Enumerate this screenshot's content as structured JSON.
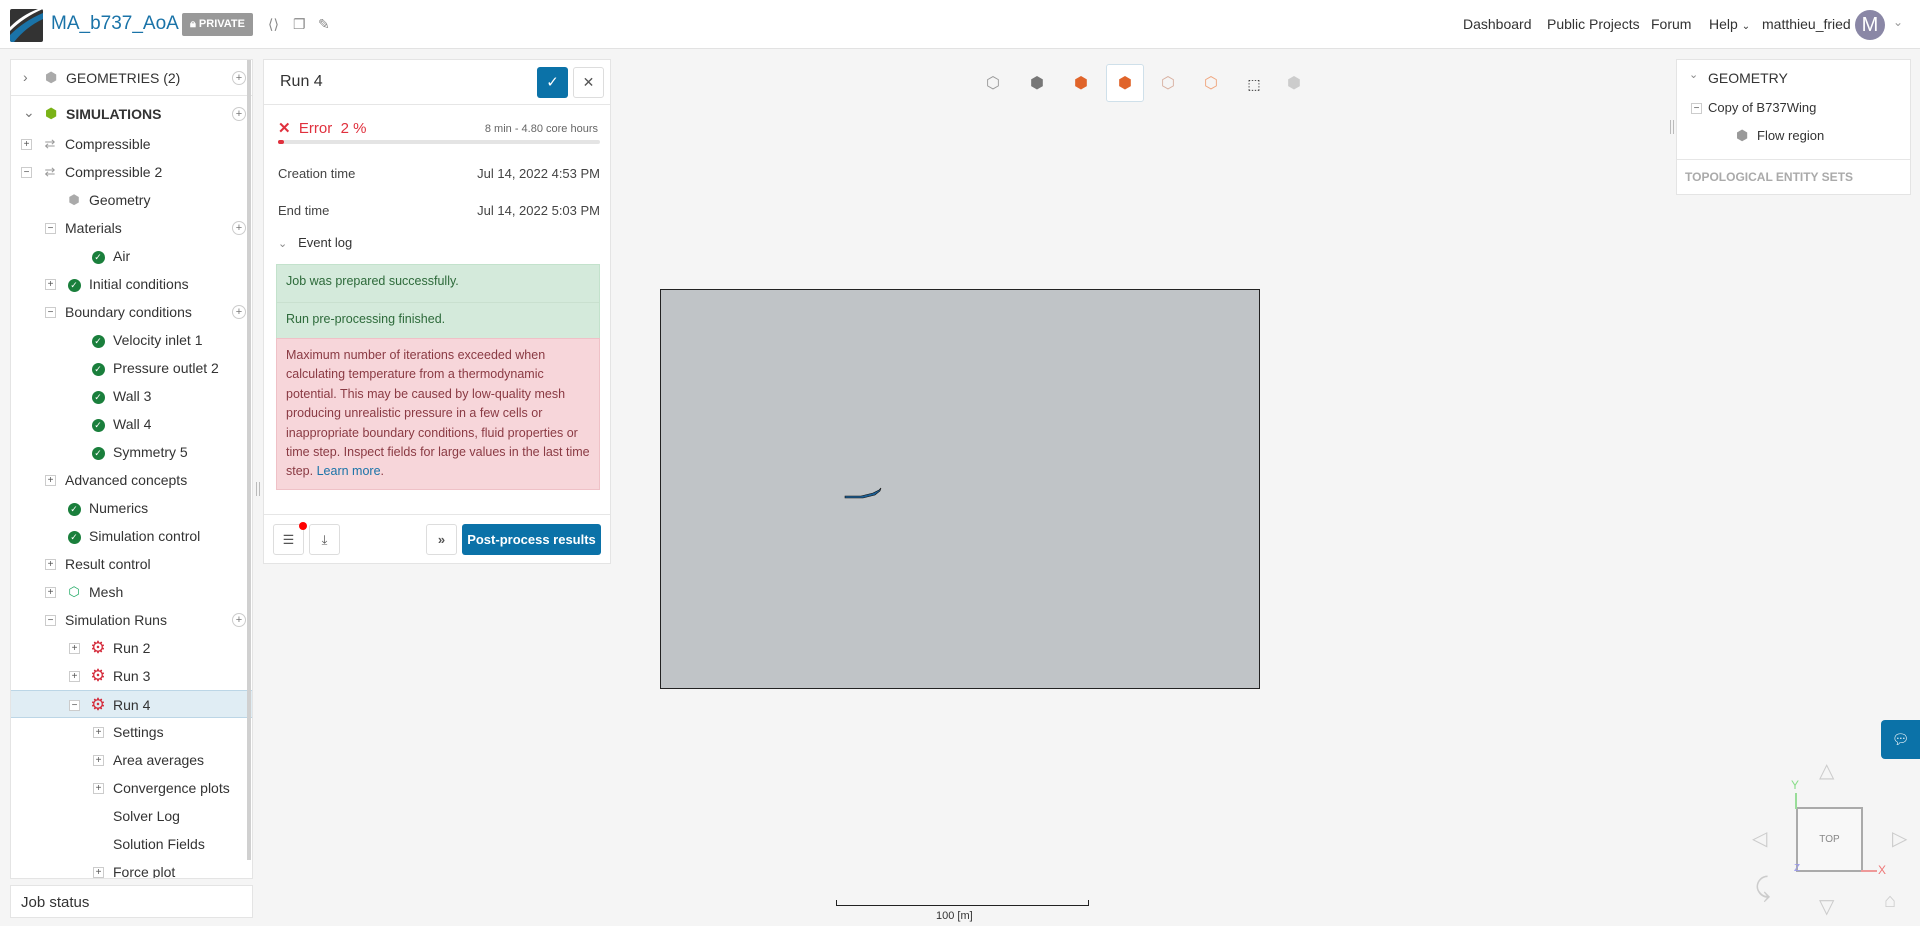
{
  "header": {
    "title": "MA_b737_AoA",
    "privacy": "PRIVATE",
    "nav": [
      "Dashboard",
      "Public Projects",
      "Forum",
      "Help"
    ],
    "user": "matthieu_fried",
    "avatar_letter": "M"
  },
  "tree": {
    "geometries": "GEOMETRIES (2)",
    "simulations": "SIMULATIONS",
    "items": [
      {
        "label": "Compressible",
        "depth": 0,
        "toggle": "+",
        "icon": "sim"
      },
      {
        "label": "Compressible 2",
        "depth": 0,
        "toggle": "−",
        "icon": "sim"
      },
      {
        "label": "Geometry",
        "depth": 1,
        "icon": "geom"
      },
      {
        "label": "Materials",
        "depth": 1,
        "toggle": "−",
        "add": true
      },
      {
        "label": "Air",
        "depth": 2,
        "icon": "check"
      },
      {
        "label": "Initial conditions",
        "depth": 1,
        "toggle": "+",
        "icon": "check"
      },
      {
        "label": "Boundary conditions",
        "depth": 1,
        "toggle": "−",
        "add": true
      },
      {
        "label": "Velocity inlet 1",
        "depth": 2,
        "icon": "check"
      },
      {
        "label": "Pressure outlet 2",
        "depth": 2,
        "icon": "check"
      },
      {
        "label": "Wall 3",
        "depth": 2,
        "icon": "check"
      },
      {
        "label": "Wall 4",
        "depth": 2,
        "icon": "check"
      },
      {
        "label": "Symmetry 5",
        "depth": 2,
        "icon": "check"
      },
      {
        "label": "Advanced concepts",
        "depth": 1,
        "toggle": "+"
      },
      {
        "label": "Numerics",
        "depth": 1,
        "icon": "check"
      },
      {
        "label": "Simulation control",
        "depth": 1,
        "icon": "check"
      },
      {
        "label": "Result control",
        "depth": 1,
        "toggle": "+"
      },
      {
        "label": "Mesh",
        "depth": 1,
        "toggle": "+",
        "icon": "mesh"
      },
      {
        "label": "Simulation Runs",
        "depth": 1,
        "toggle": "−",
        "add": true
      },
      {
        "label": "Run 2",
        "depth": 2,
        "toggle": "+",
        "icon": "gear"
      },
      {
        "label": "Run 3",
        "depth": 2,
        "toggle": "+",
        "icon": "gear"
      },
      {
        "label": "Run 4",
        "depth": 2,
        "toggle": "−",
        "icon": "gear",
        "selected": true
      },
      {
        "label": "Settings",
        "depth": 3,
        "toggle": "+"
      },
      {
        "label": "Area averages",
        "depth": 3,
        "toggle": "+"
      },
      {
        "label": "Convergence plots",
        "depth": 3,
        "toggle": "+"
      },
      {
        "label": "Solver Log",
        "depth": 3
      },
      {
        "label": "Solution Fields",
        "depth": 3
      },
      {
        "label": "Force plot",
        "depth": 3,
        "toggle": "+"
      }
    ],
    "job_status": "Job status"
  },
  "run": {
    "title": "Run 4",
    "status": "Error",
    "progress_label": "2 %",
    "progress": 0.02,
    "duration": "8 min - 4.80 core hours",
    "creation_label": "Creation time",
    "creation_value": "Jul 14, 2022 4:53 PM",
    "end_label": "End time",
    "end_value": "Jul 14, 2022 5:03 PM",
    "event_log": "Event log",
    "events_ok": [
      "Job was prepared successfully.",
      "Run pre-processing finished."
    ],
    "event_error": "Maximum number of iterations exceeded when calculating temperature from a thermodynamic potential. This may be caused by low-quality mesh producing unrealistic pressure in a few cells or inappropriate boundary conditions, fluid properties or time step. Inspect fields for large values in the last time step.",
    "learn_more": "Learn more",
    "postprocess": "Post-process results"
  },
  "geometry_panel": {
    "title": "GEOMETRY",
    "root": "Copy of B737Wing",
    "child": "Flow region",
    "sets": "TOPOLOGICAL ENTITY SETS"
  },
  "viewer": {
    "cube_face": "TOP",
    "axis_x": "X",
    "axis_y": "Y",
    "axis_z": "Z",
    "scale": "100 [m]"
  },
  "colors": {
    "accent": "#0b72a8",
    "error": "#e0303d",
    "success": "#1a7f3c"
  }
}
